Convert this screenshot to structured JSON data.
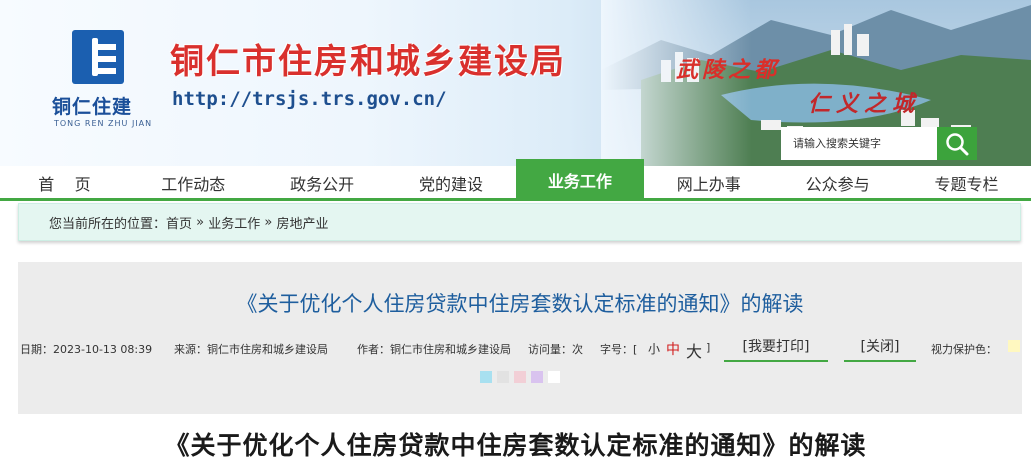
{
  "header": {
    "logo_text": "铜仁住建",
    "logo_en": "TONG REN ZHU JIAN",
    "site_title": "铜仁市住房和城乡建设局",
    "site_url": "http://trsjs.trs.gov.cn/",
    "slogan_1": "武陵之都",
    "slogan_2": "仁义之城"
  },
  "search": {
    "placeholder": "请输入搜索关键字",
    "icon": "search-icon"
  },
  "nav": {
    "items": [
      {
        "label": "首    页"
      },
      {
        "label": "工作动态"
      },
      {
        "label": "政务公开"
      },
      {
        "label": "党的建设"
      },
      {
        "label": "业务工作"
      },
      {
        "label": "网上办事"
      },
      {
        "label": "公众参与"
      },
      {
        "label": "专题专栏"
      }
    ],
    "active_index": 4
  },
  "breadcrumb": {
    "prefix": "您当前所在的位置：",
    "items": [
      "首页",
      "业务工作",
      "房地产业"
    ],
    "separator": " » "
  },
  "article": {
    "title": "《关于优化个人住房贷款中住房套数认定标准的通知》的解读",
    "meta": {
      "date": "日期：2023-10-13 08:39",
      "source": "来源：铜仁市住房和城乡建设局",
      "author": "作者：铜仁市住房和城乡建设局",
      "views": "访问量：次",
      "font_label": "字号：[",
      "font_small": "小",
      "font_mid": "中",
      "font_big": "大",
      "font_end": "]",
      "print": "[我要打印]",
      "close": "[关闭]",
      "vision": "视力保护色："
    },
    "swatches": [
      "#a8e0f0",
      "#e2e2e2",
      "#f2cfd6",
      "#d9c3ef",
      "#ffffff"
    ],
    "vision_swatch": "#fff8c0",
    "body_title": "《关于优化个人住房贷款中住房套数认定标准的通知》的解读"
  },
  "colors": {
    "accent": "#43a843",
    "title_red": "#d9302d",
    "link_blue": "#1e5e9e"
  }
}
